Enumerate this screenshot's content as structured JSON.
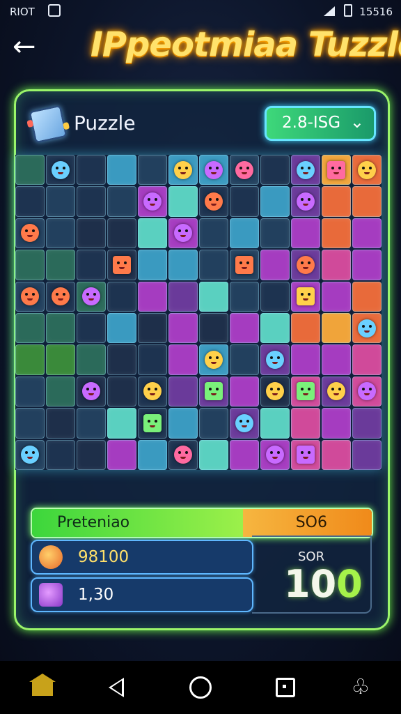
{
  "status_bar": {
    "left_text": "RIOT",
    "right_text": "15516"
  },
  "header": {
    "back_glyph": "←",
    "title": "IPpeotmiaa Tuzzld"
  },
  "panel": {
    "title": "Puzzle",
    "dropdown": {
      "selected": "2.8-ISG",
      "chevron": "⌄"
    }
  },
  "progress": {
    "label": "Preteniao",
    "value": "SO6",
    "fraction": 0.62
  },
  "stats": [
    {
      "value": "98100",
      "icon": "orange-creature-icon"
    },
    {
      "value": "1,30",
      "icon": "purple-creature-icon"
    }
  ],
  "score": {
    "label": "SOR",
    "value_main": "10",
    "value_accent": "0"
  },
  "colors": {
    "title_glow": "#ffb400",
    "panel_border": "#9bf56a",
    "progress_green": "#3cd63c",
    "progress_orange": "#f08a1a"
  },
  "nav": {
    "extra_glyph": "♧"
  }
}
